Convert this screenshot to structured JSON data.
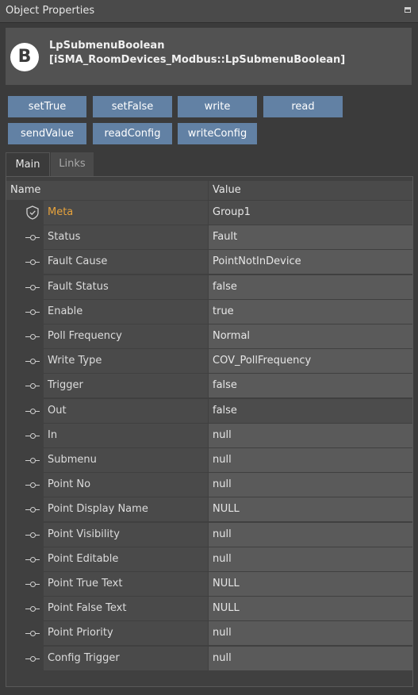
{
  "window": {
    "title": "Object Properties"
  },
  "object": {
    "badge": "B",
    "name": "LpSubmenuBoolean",
    "type": "[iSMA_RoomDevices_Modbus::LpSubmenuBoolean]"
  },
  "actions": [
    "setTrue",
    "setFalse",
    "write",
    "read",
    "sendValue",
    "readConfig",
    "writeConfig"
  ],
  "tabs": [
    {
      "label": "Main",
      "active": true
    },
    {
      "label": "Links",
      "active": false
    }
  ],
  "table": {
    "columns": [
      "Name",
      "Value"
    ],
    "rows": [
      {
        "icon": "shield-icon",
        "name": "Meta",
        "value": "Group1"
      },
      {
        "icon": "slot-icon",
        "name": "Status",
        "value": "Fault"
      },
      {
        "icon": "slot-icon",
        "name": "Fault Cause",
        "value": "PointNotInDevice"
      },
      {
        "icon": "slot-icon",
        "name": "Fault Status",
        "value": "false"
      },
      {
        "icon": "slot-icon",
        "name": "Enable",
        "value": "true"
      },
      {
        "icon": "slot-icon",
        "name": "Poll Frequency",
        "value": "Normal"
      },
      {
        "icon": "slot-icon",
        "name": "Write Type",
        "value": "COV_PollFrequency"
      },
      {
        "icon": "slot-icon",
        "name": "Trigger",
        "value": "false"
      },
      {
        "icon": "slot-icon",
        "name": "Out",
        "value": "false"
      },
      {
        "icon": "slot-icon",
        "name": "In",
        "value": "null"
      },
      {
        "icon": "slot-icon",
        "name": "Submenu",
        "value": "null"
      },
      {
        "icon": "slot-icon",
        "name": "Point No",
        "value": "null"
      },
      {
        "icon": "slot-icon",
        "name": "Point Display Name",
        "value": "NULL"
      },
      {
        "icon": "slot-icon",
        "name": "Point Visibility",
        "value": "null"
      },
      {
        "icon": "slot-icon",
        "name": "Point Editable",
        "value": "null"
      },
      {
        "icon": "slot-icon",
        "name": "Point True Text",
        "value": "NULL"
      },
      {
        "icon": "slot-icon",
        "name": "Point False Text",
        "value": "NULL"
      },
      {
        "icon": "slot-icon",
        "name": "Point Priority",
        "value": "null"
      },
      {
        "icon": "slot-icon",
        "name": "Config Trigger",
        "value": "null"
      }
    ]
  },
  "colors": {
    "button": "#6281a4",
    "meta_label": "#e6a23c",
    "background": "#3b3b3b"
  }
}
